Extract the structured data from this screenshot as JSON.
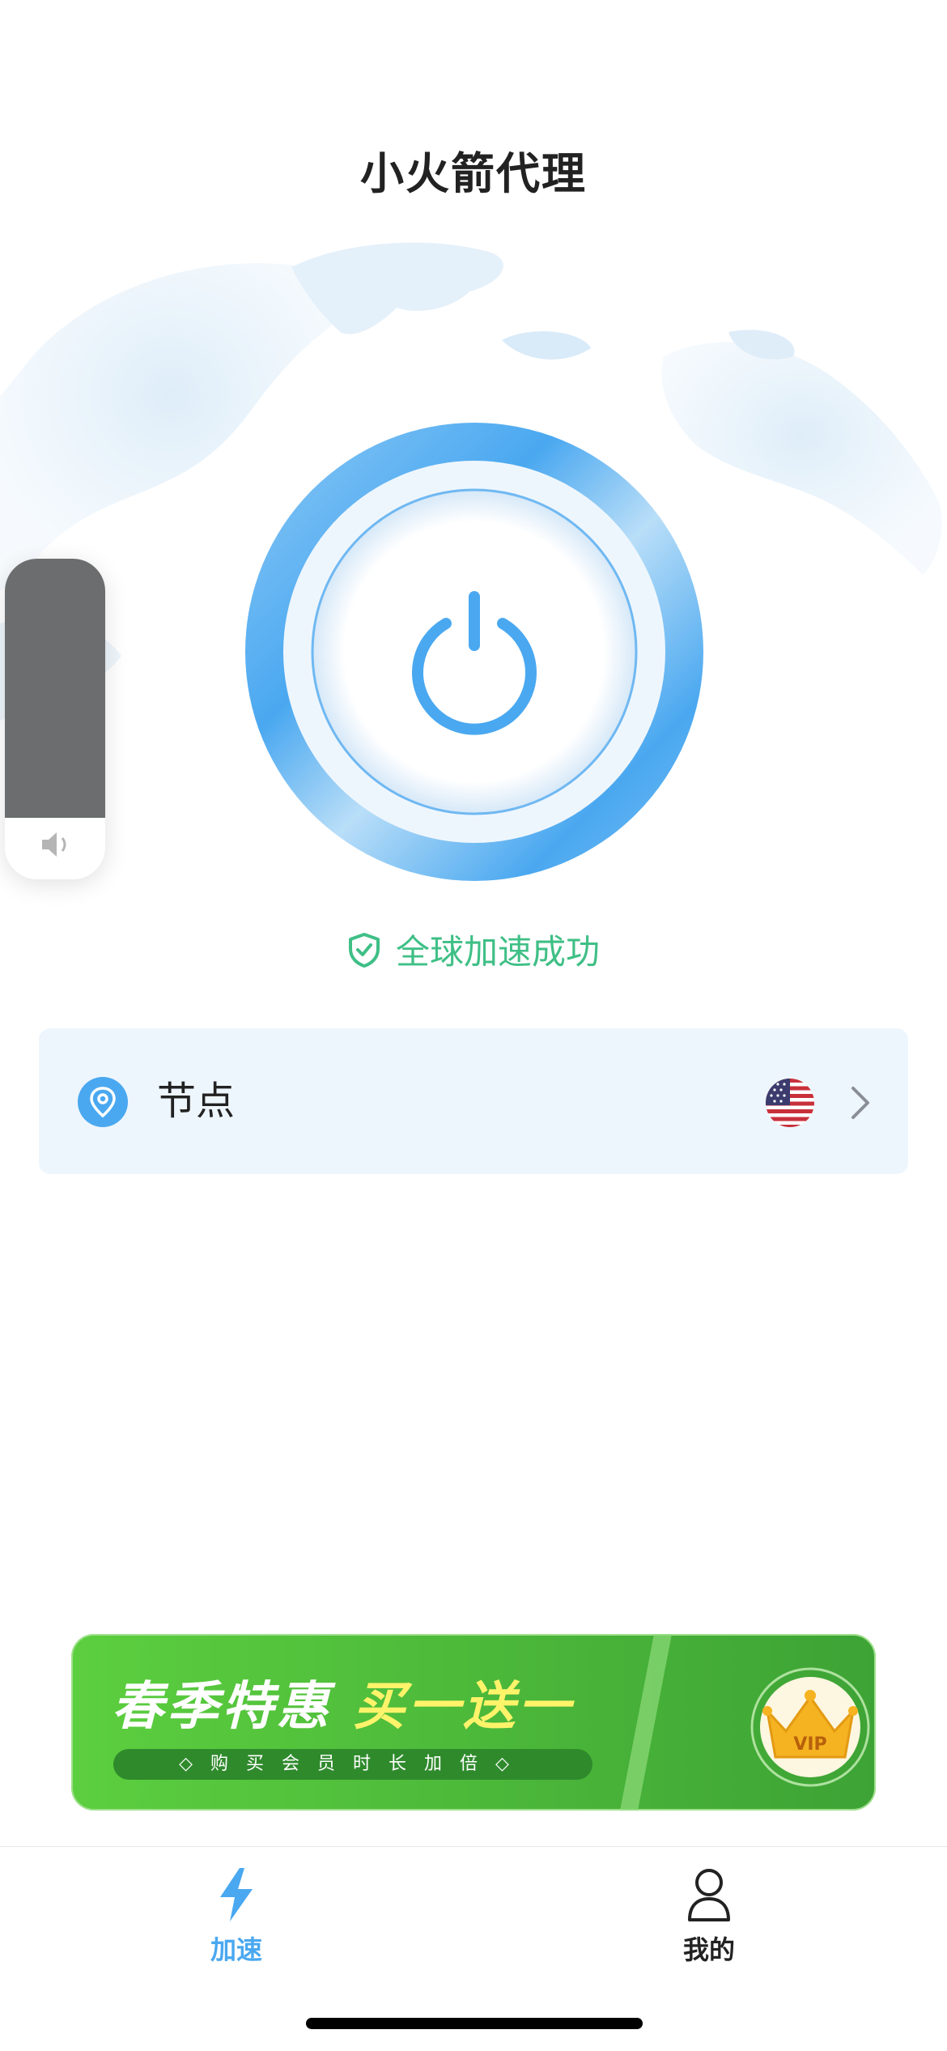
{
  "app": {
    "title": "小火箭代理"
  },
  "connection": {
    "status_text": "全球加速成功",
    "connected": true
  },
  "node": {
    "label": "节点",
    "selected_region_flag": "us-flag-icon"
  },
  "banner": {
    "headline_part1": "春季特惠",
    "headline_part2": "买一送一",
    "subline": "◇购买会员时长加倍◇",
    "badge_text": "VIP"
  },
  "tabs": [
    {
      "label": "加速",
      "icon": "lightning-icon",
      "active": true
    },
    {
      "label": "我的",
      "icon": "user-icon",
      "active": false
    }
  ],
  "colors": {
    "accent": "#4aa8f0",
    "success": "#3fbf86",
    "card_bg": "#eef6fd",
    "banner_green": "#4dbf3a"
  }
}
